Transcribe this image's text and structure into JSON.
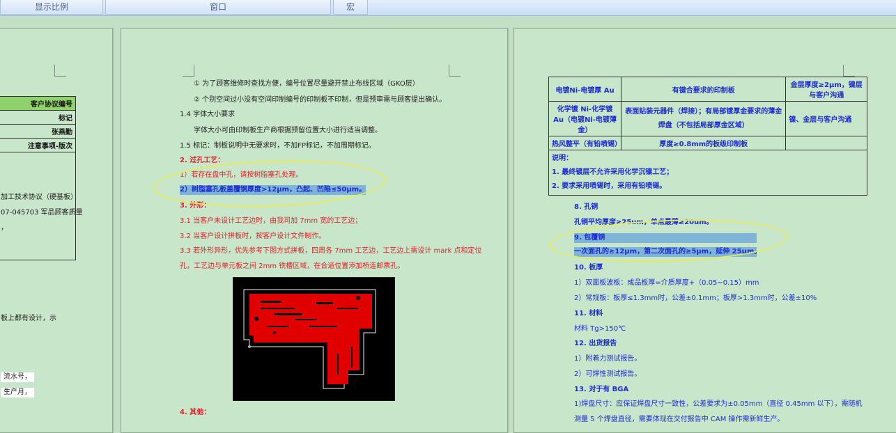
{
  "ribbon": {
    "groups": [
      "显示比例",
      "窗口",
      "宏"
    ]
  },
  "left_page": {
    "table_rows": [
      "客户协议编号",
      "标记",
      "张燕勤",
      "注意事项-版次"
    ],
    "text_lines": [
      "加工技术协议（硬基板）",
      "07-045703 军品顾客质量",
      "，",
      "板上都有设计，示",
      "流水号，",
      "生产月，"
    ]
  },
  "mid_page": {
    "lines": [
      "①  为了顾客维修时查找方便，编号位置尽量避开禁止布线区域（GKO层）",
      "②  个别空间过小没有空间印制编号的印制板不印制，但是预审需与顾客提出确认。",
      "1.4 字体大小要求",
      "字体大小可由印制板生产商根据预留位置大小进行适当调整。",
      "1.5 标记：制板说明中无要求时，不加FP标记，不加周期标记。",
      "2. 过孔工艺：",
      "1）若存在盘中孔，请按树脂塞孔处理。",
      "2）树脂塞孔板盖覆铜厚度>12μm，凸起、凹陷≤50μm。",
      "3. 外形：",
      "3.1 当客户未设计工艺边时，由我司加 7mm 宽的工艺边；",
      "3.2 当客户设计拼板时，按客户设计文件制作。",
      "3.3 若外形异形，优先参考下图方式拼板，四周各 7mm 工艺边，工艺边上需设计 mark 点和定位",
      "孔，工艺边与单元板之间 2mm 铣槽区域，在合适位置添加桥连邮票孔。",
      "4. 其他："
    ]
  },
  "right_page": {
    "table": [
      [
        "电镀Ni-电镀厚 Au",
        "有键合要求的印制板",
        "金层厚度≥2μm，镍层与客户沟通"
      ],
      [
        "化学镀 Ni-化学镀 Au（电镀Ni-电镀薄金）",
        "表面贴装元器件（焊接）；有局部镀厚金要求的薄金焊盘（不包括局部厚金区域）",
        "镍、金层与客户沟通"
      ],
      [
        "热风整平（有铅喷锡）",
        "厚度≥0.8mm的板级印制板",
        ""
      ]
    ],
    "note_title": "说明：",
    "notes": [
      "1. 最终镀层不允许采用化学沉镍工艺；",
      "2. 要求采用喷锡时，采用有铅喷锡。"
    ],
    "lines": [
      "8. 孔铜",
      "孔铜平均厚度≥25um，单点最薄≥20um。",
      "9. 包覆铜",
      "一次面孔的≥12μm，第二次面孔的≥5μm，延伸 25μm。",
      "10. 板厚",
      "1）双面板波板：成品板厚=介质厚度+（0.05~0.15）mm",
      "2）常规板：板厚≤1.3mm时，公差±0.1mm；板厚>1.3mm时，公差±10%",
      "11. 材料",
      "材料 Tg>150℃",
      "12. 出货报告",
      "1）附着力测试报告。",
      "2）可焊性测试报告。",
      "13. 对于有 BGA",
      "1)焊盘尺寸：应保证焊盘尺寸一致性，公差要求为±0.05mm（直径 0.45mm 以下），需随机",
      "测量 5 个焊盘直径，需要体现在交付报告中 CAM 操作需新鲜生产。"
    ]
  }
}
